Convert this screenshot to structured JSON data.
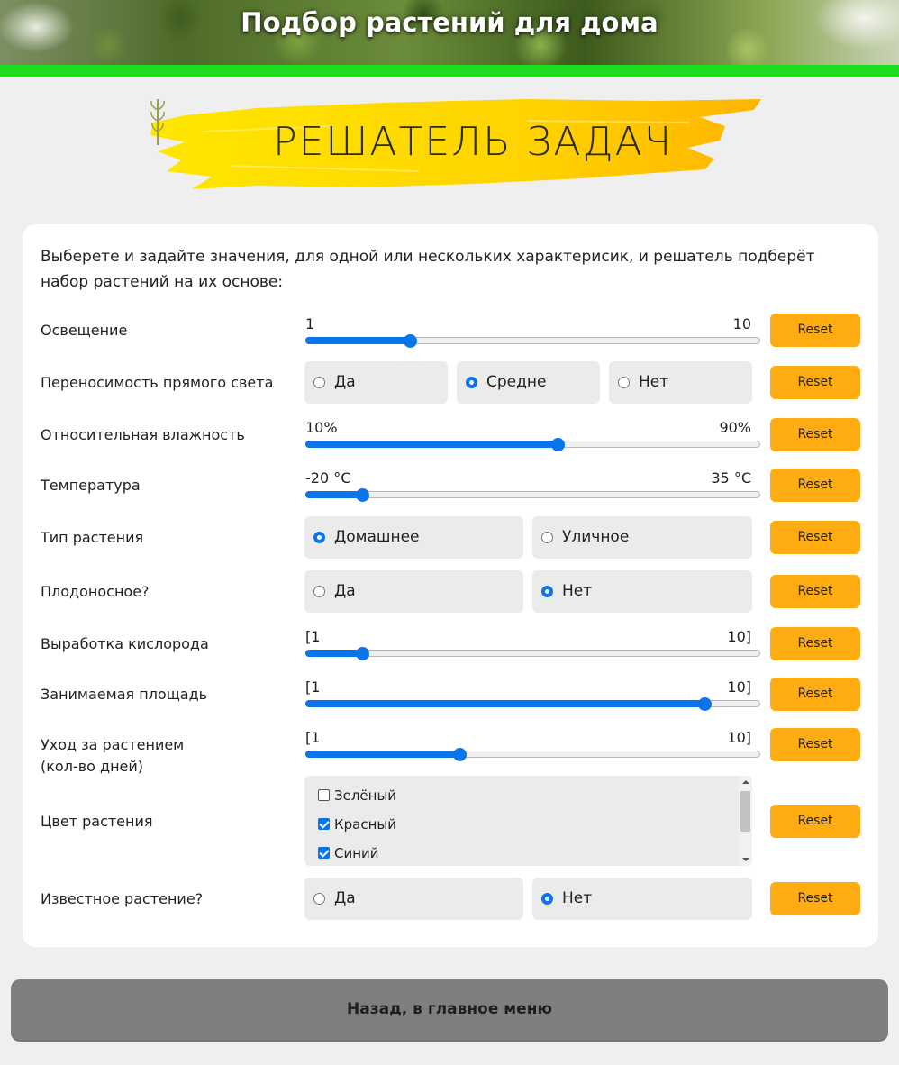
{
  "header": {
    "title": "Подбор растений для дома"
  },
  "logo": {
    "text": "РЕШАТЕЛЬ ЗАДАЧ"
  },
  "intro": "Выберете и задайте значения, для одной или нескольких характерисик, и решатель подберёт набор растений на их основе:",
  "reset_label": "Reset",
  "colors": {
    "accent": "#0a74ea",
    "reset": "#ffac12",
    "green_bar": "#1ddb1d",
    "back_button": "#7f7f7f"
  },
  "rows": {
    "lighting": {
      "label": "Освещение",
      "min": "1",
      "max": "10",
      "value_fraction": 0.23
    },
    "direct_light": {
      "label": "Переносимость прямого света",
      "options": [
        "Да",
        "Средне",
        "Нет"
      ],
      "selected": "Средне"
    },
    "humidity": {
      "label": "Относительная влажность",
      "min": "10%",
      "max": "90%",
      "value_fraction": 0.555
    },
    "temperature": {
      "label": "Температура",
      "min": "-20 °C",
      "max": "35 °C",
      "value_fraction": 0.125
    },
    "plant_type": {
      "label": "Тип растения",
      "options": [
        "Домашнее",
        "Уличное"
      ],
      "selected": "Домашнее"
    },
    "fruiting": {
      "label": "Плодоносное?",
      "options": [
        "Да",
        "Нет"
      ],
      "selected": "Нет"
    },
    "oxygen": {
      "label": "Выработка кислорода",
      "min": "[1",
      "max": "10]",
      "value_fraction": 0.125
    },
    "area": {
      "label": "Занимаемая площадь",
      "min": "[1",
      "max": "10]",
      "value_fraction": 0.877
    },
    "care": {
      "label_line1": "Уход за растением",
      "label_line2": "(кол-во дней)",
      "min": "[1",
      "max": "10]",
      "value_fraction": 0.338
    },
    "color": {
      "label": "Цвет растения",
      "options": [
        {
          "label": "Зелёный",
          "checked": false
        },
        {
          "label": "Красный",
          "checked": true
        },
        {
          "label": "Синий",
          "checked": true
        }
      ]
    },
    "known": {
      "label": "Известное растение?",
      "options": [
        "Да",
        "Нет"
      ],
      "selected": "Нет"
    }
  },
  "back_button": "Назад, в главное меню"
}
